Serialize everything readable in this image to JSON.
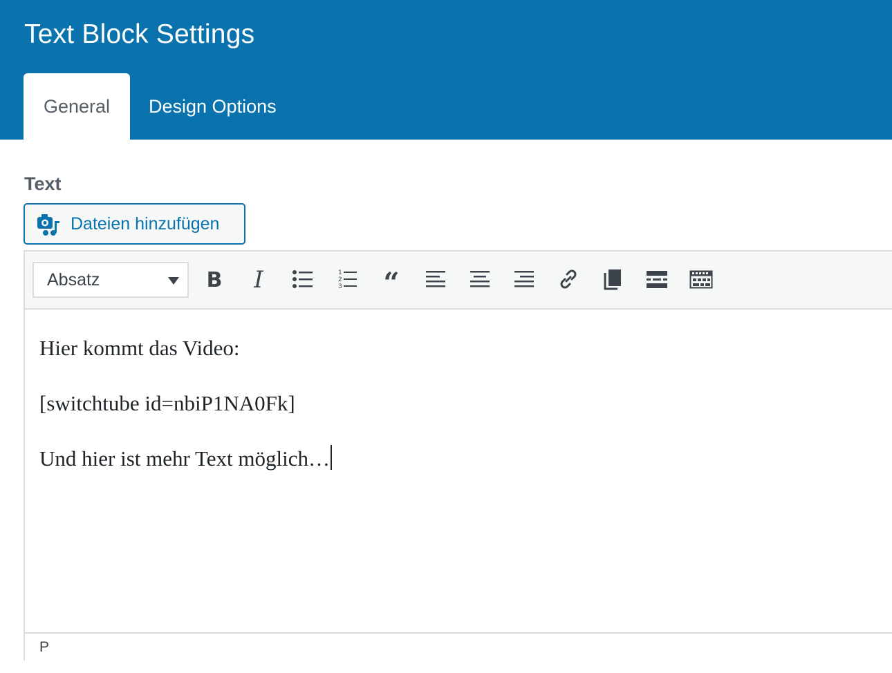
{
  "window": {
    "title": "Text Block Settings"
  },
  "tabs": [
    {
      "label": "General",
      "active": true
    },
    {
      "label": "Design Options",
      "active": false
    }
  ],
  "field": {
    "label": "Text",
    "add_media_label": "Dateien hinzufügen"
  },
  "toolbar": {
    "format_select": {
      "selected": "Absatz"
    },
    "buttons": [
      {
        "icon": "bold-icon"
      },
      {
        "icon": "italic-icon"
      },
      {
        "icon": "bulleted-list-icon"
      },
      {
        "icon": "numbered-list-icon"
      },
      {
        "icon": "blockquote-icon"
      },
      {
        "icon": "align-left-icon"
      },
      {
        "icon": "align-center-icon"
      },
      {
        "icon": "align-right-icon"
      },
      {
        "icon": "link-icon"
      },
      {
        "icon": "paste-icon"
      },
      {
        "icon": "read-more-icon"
      },
      {
        "icon": "toolbar-toggle-icon"
      }
    ]
  },
  "editor": {
    "paragraphs": [
      "Hier kommt das Video:",
      "[switchtube id=nbiP1NA0Fk]",
      "Und hier ist mehr Text möglich…"
    ],
    "status_path": "P"
  },
  "colors": {
    "header_bg": "#0a73ad",
    "accent": "#0a73ad",
    "border": "#dcdcde"
  }
}
